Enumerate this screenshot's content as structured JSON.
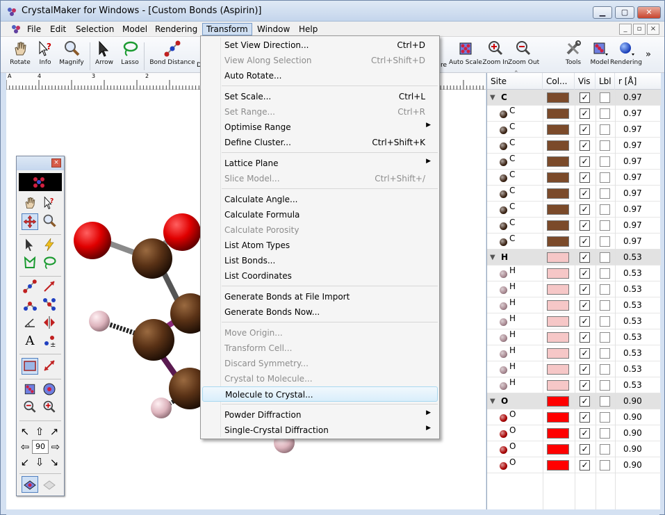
{
  "window": {
    "title": "CrystalMaker for Windows - [Custom Bonds (Aspirin)]"
  },
  "menubar": {
    "items": [
      "File",
      "Edit",
      "Selection",
      "Model",
      "Rendering",
      "Transform",
      "Window",
      "Help"
    ],
    "active": "Transform"
  },
  "toolbar": {
    "left": [
      "Rotate",
      "Info",
      "Magnify",
      "Arrow",
      "Lasso",
      "Bond Distance"
    ],
    "partial": [
      "D",
      "re"
    ],
    "right": [
      "Auto Scale",
      "Zoom In",
      "Zoom Out",
      "Tools",
      "Model",
      "Rendering"
    ],
    "overflow": "»"
  },
  "ruler": {
    "labels": [
      "A",
      "4",
      "3",
      "2"
    ]
  },
  "palette": {
    "rotation_value": "90"
  },
  "transform_menu": {
    "items": [
      {
        "label": "Set View Direction...",
        "shortcut": "Ctrl+D",
        "enabled": true
      },
      {
        "label": "View Along Selection",
        "shortcut": "Ctrl+Shift+D",
        "enabled": false
      },
      {
        "label": "Auto Rotate...",
        "shortcut": "",
        "enabled": true
      },
      {
        "label": "Set Scale...",
        "shortcut": "Ctrl+L",
        "enabled": true
      },
      {
        "label": "Set Range...",
        "shortcut": "Ctrl+R",
        "enabled": false
      },
      {
        "label": "Optimise Range",
        "shortcut": "",
        "enabled": true,
        "submenu": true
      },
      {
        "label": "Define Cluster...",
        "shortcut": "Ctrl+Shift+K",
        "enabled": true
      },
      {
        "label": "Lattice Plane",
        "shortcut": "",
        "enabled": true,
        "submenu": true
      },
      {
        "label": "Slice Model...",
        "shortcut": "Ctrl+Shift+/",
        "enabled": false
      },
      {
        "label": "Calculate Angle...",
        "shortcut": "",
        "enabled": true
      },
      {
        "label": "Calculate Formula",
        "shortcut": "",
        "enabled": true
      },
      {
        "label": "Calculate Porosity",
        "shortcut": "",
        "enabled": false
      },
      {
        "label": "List Atom Types",
        "shortcut": "",
        "enabled": true
      },
      {
        "label": "List Bonds...",
        "shortcut": "",
        "enabled": true
      },
      {
        "label": "List Coordinates",
        "shortcut": "",
        "enabled": true
      },
      {
        "label": "Generate Bonds at File Import",
        "shortcut": "",
        "enabled": true
      },
      {
        "label": "Generate Bonds Now...",
        "shortcut": "",
        "enabled": true
      },
      {
        "label": "Move Origin...",
        "shortcut": "",
        "enabled": false
      },
      {
        "label": "Transform Cell...",
        "shortcut": "",
        "enabled": false
      },
      {
        "label": "Discard Symmetry...",
        "shortcut": "",
        "enabled": false
      },
      {
        "label": "Crystal to Molecule...",
        "shortcut": "",
        "enabled": false
      },
      {
        "label": "Molecule to Crystal...",
        "shortcut": "",
        "enabled": true,
        "highlighted": true
      },
      {
        "label": "Powder Diffraction",
        "shortcut": "",
        "enabled": true,
        "submenu": true
      },
      {
        "label": "Single-Crystal Diffraction",
        "shortcut": "",
        "enabled": true,
        "submenu": true
      }
    ]
  },
  "site_table": {
    "headers": [
      "Site",
      "Col...",
      "Vis",
      "Lbl",
      "r [Å]"
    ],
    "groups": [
      {
        "element": "C",
        "radius": "0.97",
        "color": "#7b4a2a",
        "ball": "#3b2314",
        "count": 9
      },
      {
        "element": "H",
        "radius": "0.53",
        "color": "#f6c7c7",
        "ball": "#a78790",
        "count": 8
      },
      {
        "element": "O",
        "radius": "0.90",
        "color": "#ff0000",
        "ball": "#a80000",
        "count": 4
      }
    ]
  }
}
